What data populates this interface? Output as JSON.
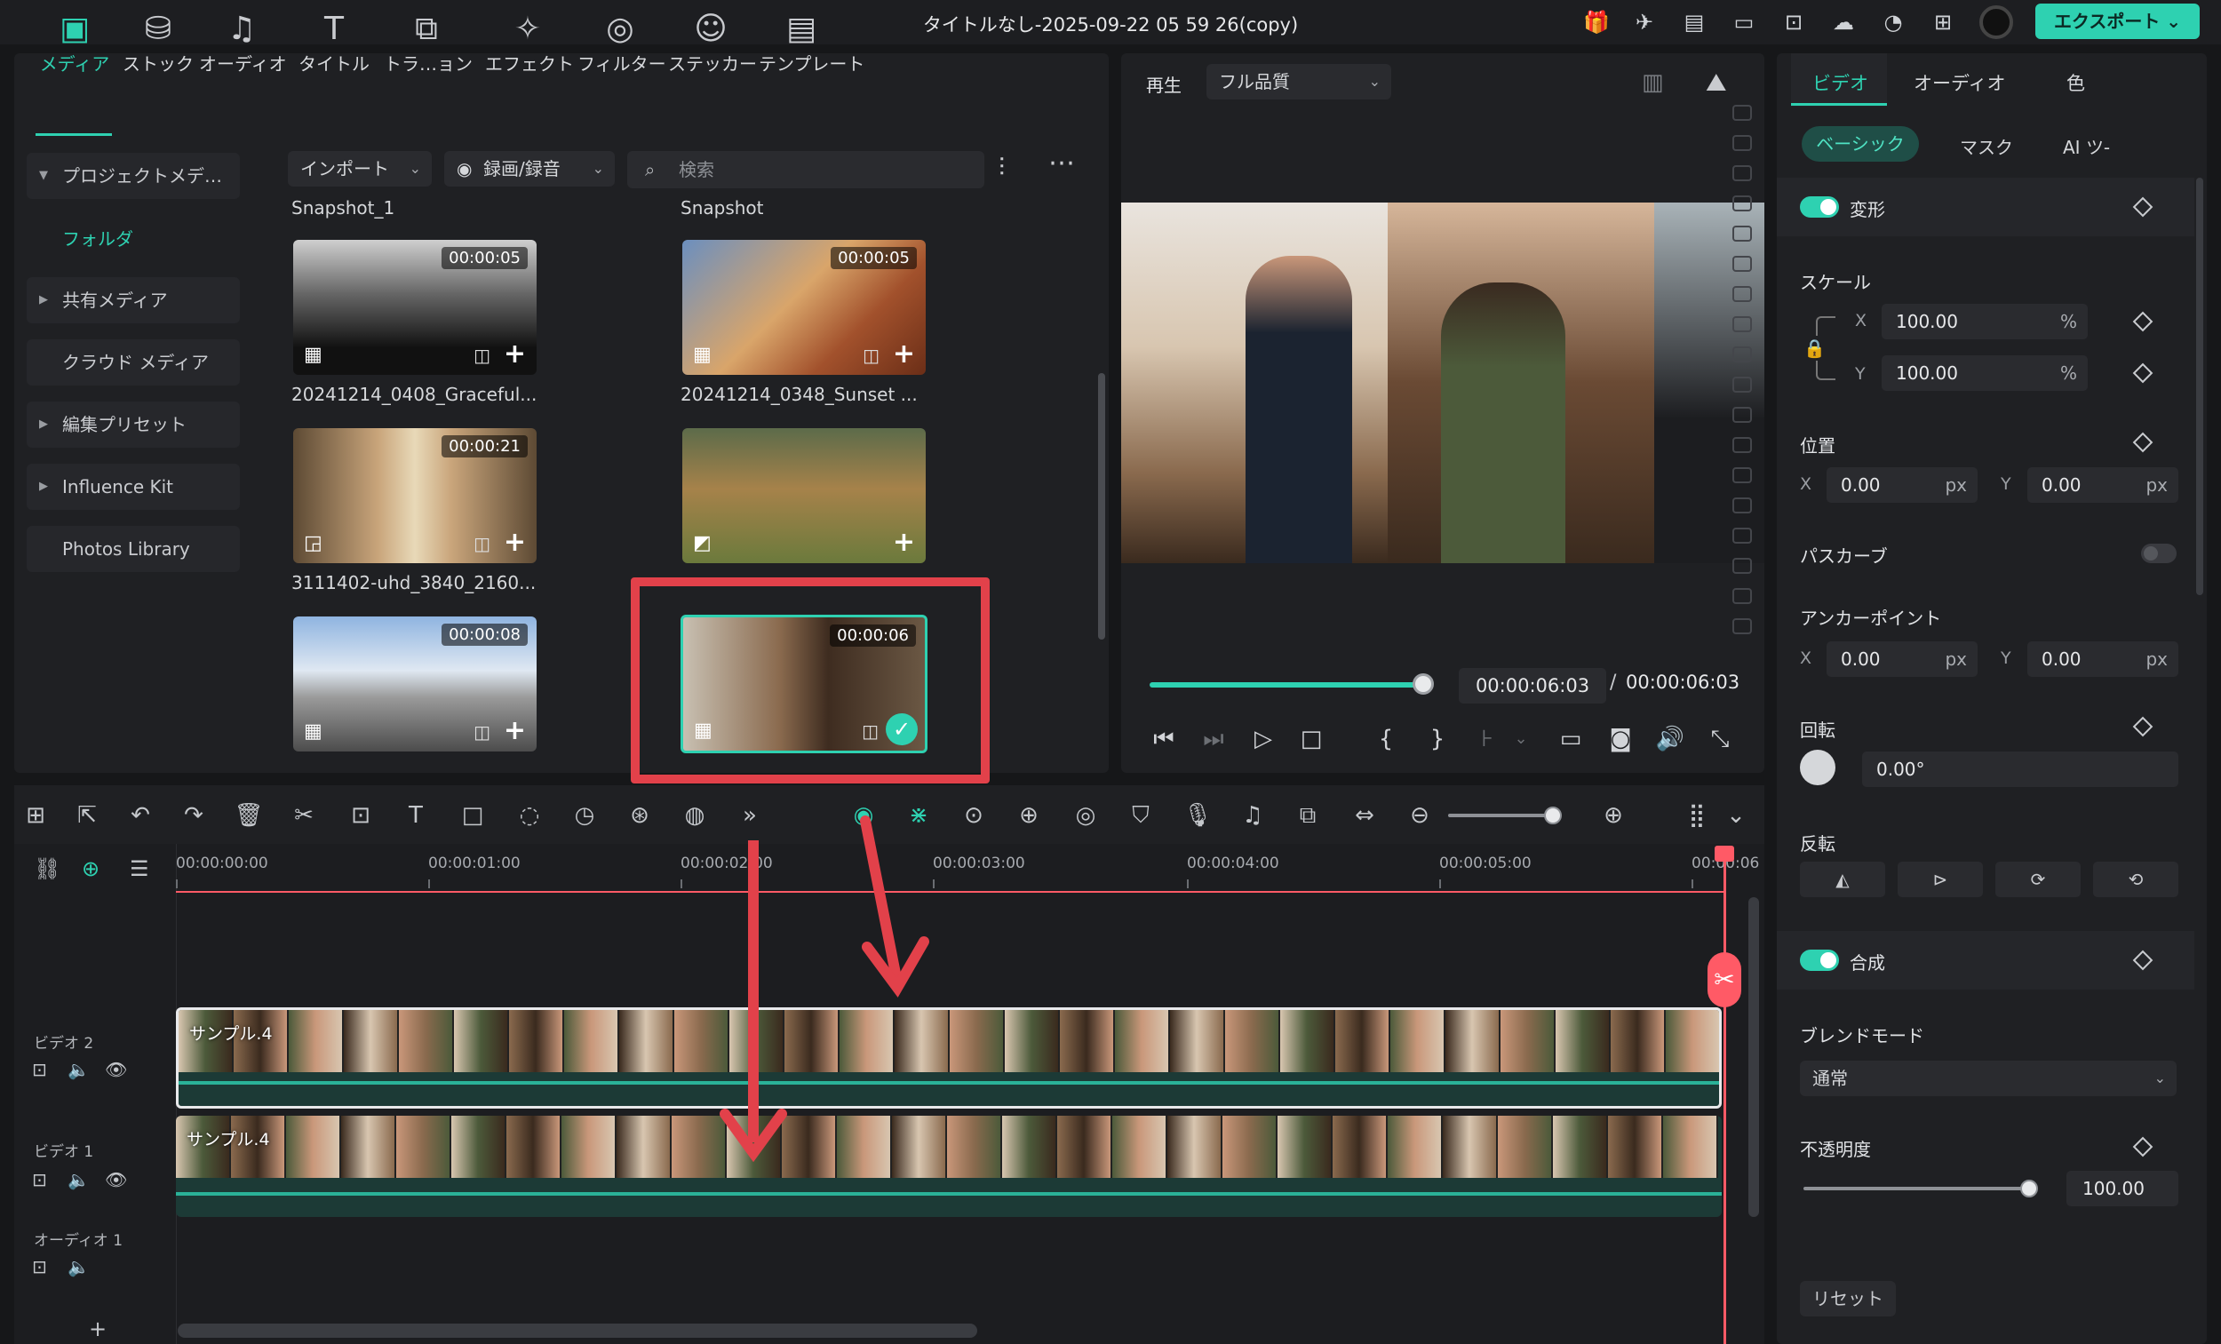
{
  "titlebar": {
    "title": "タイトルなし-2025-09-22 05 59 26(copy)",
    "export_label": "エクスポート ⌄"
  },
  "media_tabs": [
    {
      "label": "メディア",
      "icon": "media-icon",
      "glyph": "▣"
    },
    {
      "label": "ストック",
      "icon": "stock-icon",
      "glyph": "⛁"
    },
    {
      "label": "オーディオ",
      "icon": "audio-icon",
      "glyph": "♫"
    },
    {
      "label": "タイトル",
      "icon": "title-icon",
      "glyph": "T"
    },
    {
      "label": "トラ…ョン",
      "icon": "transition-icon",
      "glyph": "⧉"
    },
    {
      "label": "エフェクト",
      "icon": "effect-icon",
      "glyph": "✧"
    },
    {
      "label": "フィルター",
      "icon": "filter-icon",
      "glyph": "◎"
    },
    {
      "label": "ステッカー",
      "icon": "sticker-icon",
      "glyph": "☺"
    },
    {
      "label": "テンプレート",
      "icon": "template-icon",
      "glyph": "▤"
    }
  ],
  "sidebar": {
    "project_media": "プロジェクトメデ…",
    "folder": "フォルダ",
    "shared_media": "共有メディア",
    "cloud_media": "クラウド メディア",
    "edit_presets": "編集プリセット",
    "influence_kit": "Influence Kit",
    "photos_library": "Photos Library"
  },
  "media_toolbar": {
    "import_label": "インポート",
    "record_label": "録画/録音",
    "search_placeholder": "検索"
  },
  "media_groups": {
    "left": "Snapshot_1",
    "right": "Snapshot"
  },
  "media_items": [
    {
      "name": "20241214_0408_Graceful...",
      "duration": "00:00:05"
    },
    {
      "name": "20241214_0348_Sunset ...",
      "duration": "00:00:05"
    },
    {
      "name": "3111402-uhd_3840_2160...",
      "duration": "00:00:21"
    },
    {
      "name": "",
      "duration": ""
    },
    {
      "name": "",
      "duration": "00:00:08"
    },
    {
      "name": "",
      "duration": "00:00:06"
    }
  ],
  "preview": {
    "play_label": "再生",
    "quality": "フル品質",
    "current_time": "00:00:06:03",
    "separator": "/",
    "total_time": "00:00:06:03",
    "progress": 1.0
  },
  "inspector": {
    "tabs": [
      "ビデオ",
      "オーディオ",
      "色"
    ],
    "subtabs": [
      "ベーシック",
      "マスク",
      "AI ツ-"
    ],
    "transform_label": "変形",
    "scale_label": "スケール",
    "scale_x": "100.00",
    "scale_y": "100.00",
    "percent": "%",
    "position_label": "位置",
    "pos_x": "0.00",
    "pos_y": "0.00",
    "px": "px",
    "path_curve_label": "パスカーブ",
    "anchor_label": "アンカーポイント",
    "anchor_x": "0.00",
    "anchor_y": "0.00",
    "rotation_label": "回転",
    "rotation": "0.00°",
    "flip_label": "反転",
    "composite_label": "合成",
    "blend_label": "ブレンドモード",
    "blend_value": "通常",
    "opacity_label": "不透明度",
    "opacity": "100.00",
    "reset_label": "リセット",
    "x": "X",
    "y": "Y"
  },
  "timeline": {
    "ruler": [
      "00:00:00:00",
      "00:00:01:00",
      "00:00:02:00",
      "00:00:03:00",
      "00:00:04:00",
      "00:00:05:00",
      "00:00:06"
    ],
    "tracks": [
      {
        "name": "ビデオ 2",
        "clip": "サンプル.4"
      },
      {
        "name": "ビデオ 1",
        "clip": "サンプル.4"
      },
      {
        "name": "オーディオ 1",
        "clip": ""
      }
    ],
    "zoom": 0.75
  },
  "colors": {
    "accent": "#2ed1b1",
    "annotation": "#e2414a",
    "playhead": "#ff5a66"
  }
}
